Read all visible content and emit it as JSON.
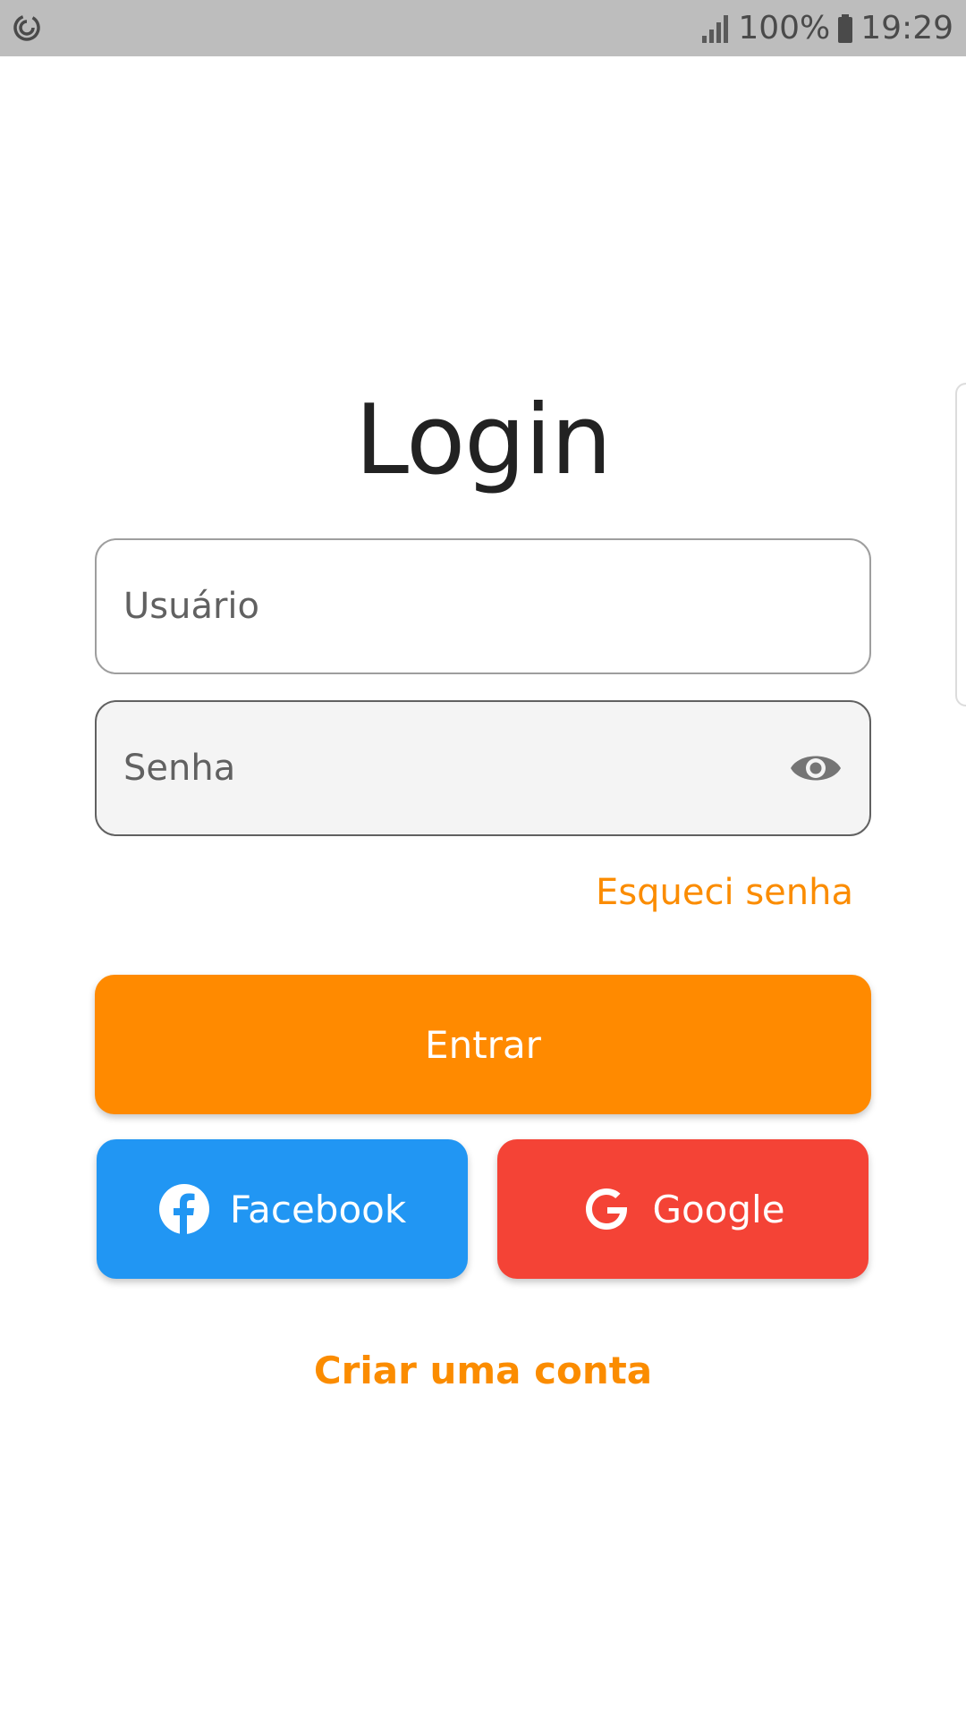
{
  "status_bar": {
    "battery_percent": "100%",
    "time": "19:29",
    "left_icon": "sync-icon",
    "signal_icon": "signal-icon",
    "battery_icon": "battery-icon"
  },
  "login": {
    "title": "Login",
    "username": {
      "placeholder": "Usuário",
      "value": ""
    },
    "password": {
      "placeholder": "Senha",
      "value": "",
      "toggle_icon": "eye-icon"
    },
    "forgot_label": "Esqueci senha",
    "submit_label": "Entrar",
    "facebook_label": "Facebook",
    "google_label": "Google",
    "create_account_label": "Criar uma conta"
  },
  "colors": {
    "accent": "#ff8a00",
    "facebook": "#2196f3",
    "google": "#f44336",
    "status_bar": "#bdbdbd"
  }
}
